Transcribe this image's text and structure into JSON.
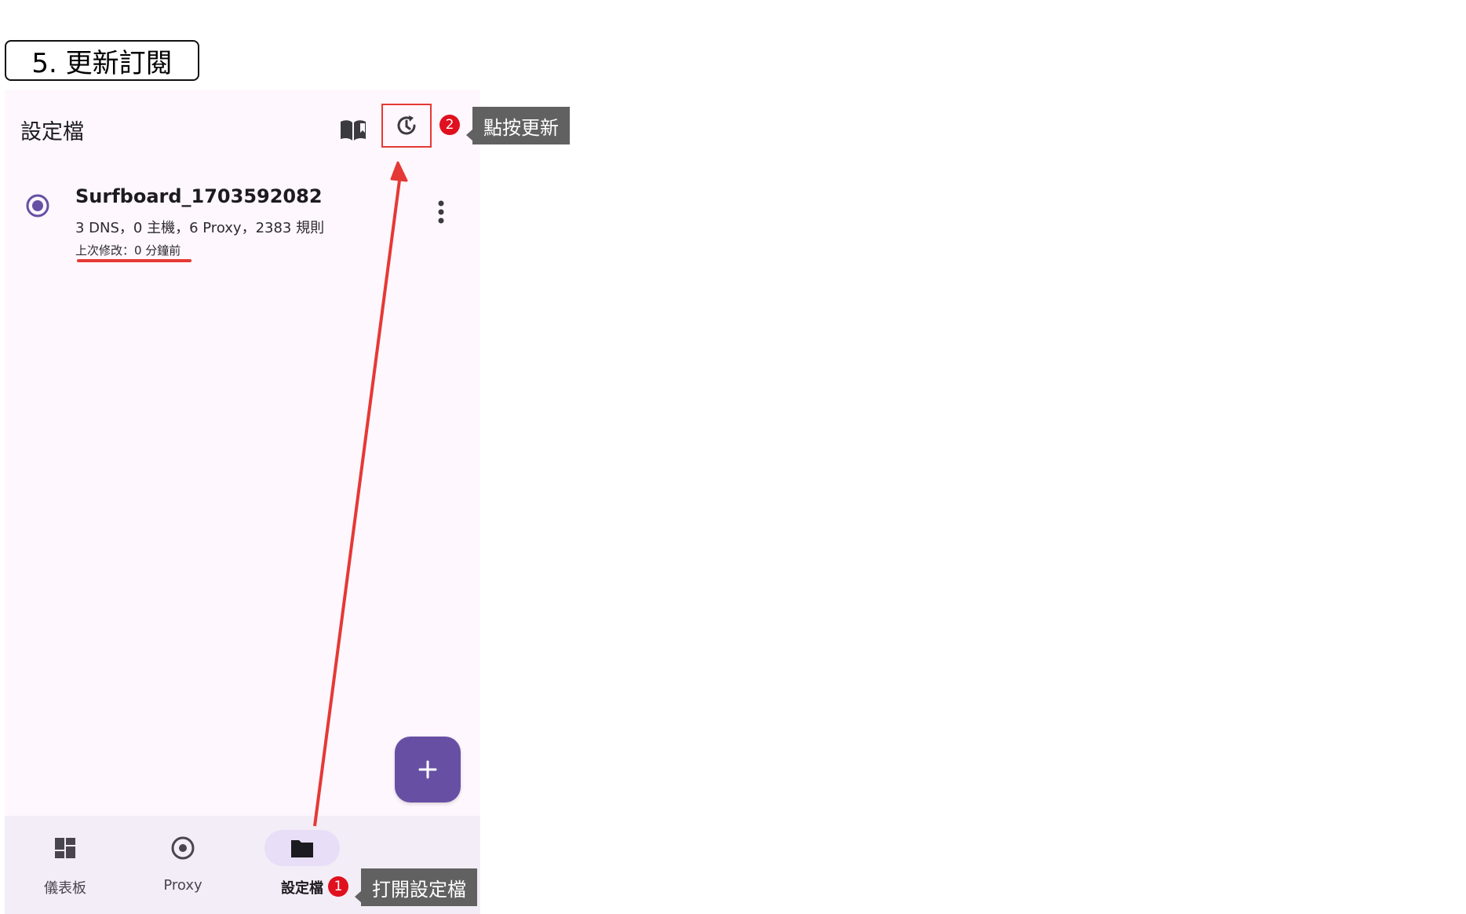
{
  "step": {
    "title": "5. 更新訂閱"
  },
  "header": {
    "title": "設定檔",
    "book_icon": "book-open-icon",
    "refresh_icon": "refresh-icon"
  },
  "profile": {
    "name": "Surfboard_1703592082",
    "stats": "3 DNS，0 主機，6 Proxy，2383 規則",
    "modified": "上次修改：0 分鐘前"
  },
  "fab": {
    "label": "+"
  },
  "nav": {
    "items": [
      {
        "label": "儀表板",
        "icon": "dashboard-icon",
        "active": false
      },
      {
        "label": "Proxy",
        "icon": "proxy-icon",
        "active": false
      },
      {
        "label": "設定檔",
        "icon": "folder-icon",
        "active": true
      }
    ]
  },
  "annotations": {
    "step1": {
      "badge": "1",
      "text": "打開設定檔"
    },
    "step2": {
      "badge": "2",
      "text": "點按更新"
    }
  },
  "colors": {
    "accent": "#6750a4",
    "annotation_red": "#e53935",
    "callout_bg": "#616161"
  }
}
